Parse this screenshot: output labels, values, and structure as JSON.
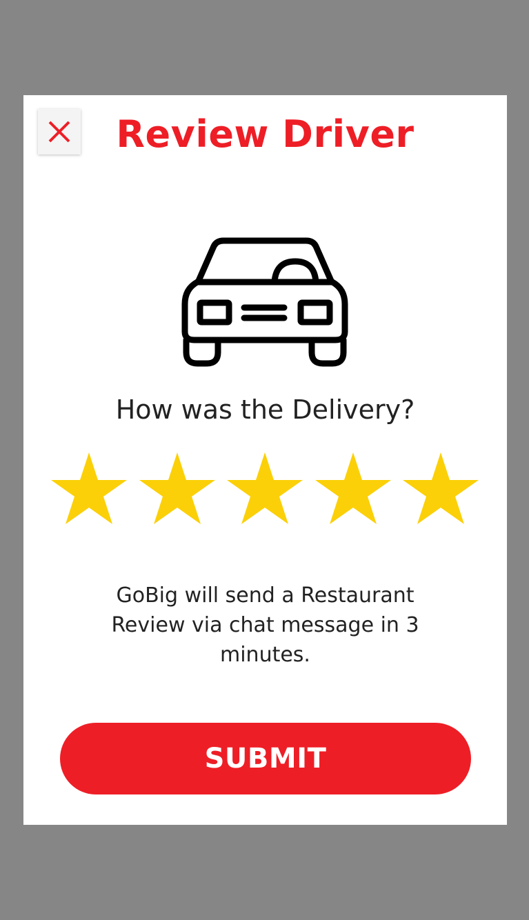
{
  "modal": {
    "title": "Review Driver",
    "close_icon": "close-icon",
    "illustration_icon": "car-icon",
    "question": "How was the Delivery?",
    "rating": {
      "value": 5,
      "max": 5,
      "star_icon": "star-icon",
      "star_color": "#FBD008"
    },
    "info_text": "GoBig will send a Restaurant Review via chat message in 3 minutes.",
    "submit_label": "SUBMIT"
  },
  "colors": {
    "accent": "#EE1E26",
    "backdrop": "#868686",
    "modal_bg": "#FFFFFF",
    "text": "#222222"
  }
}
